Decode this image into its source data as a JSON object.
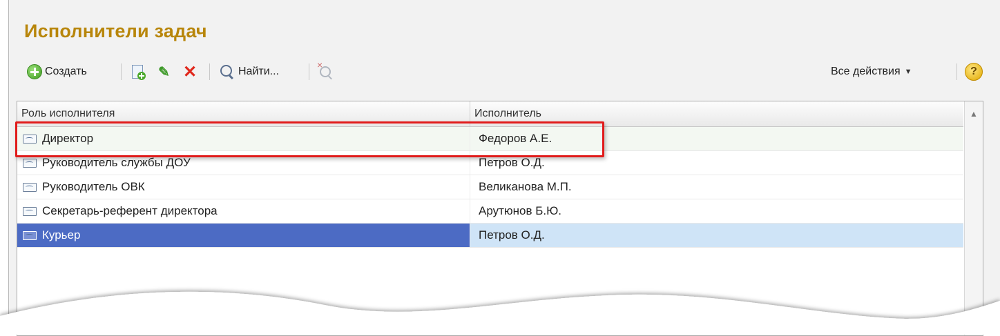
{
  "form": {
    "title": "Исполнители задач"
  },
  "toolbar": {
    "create_label": "Создать",
    "find_label": "Найти...",
    "all_actions_label": "Все действия",
    "all_actions_caret": "▼",
    "help_label": "?"
  },
  "table": {
    "columns": [
      "Роль исполнителя",
      "Исполнитель"
    ],
    "rows": [
      {
        "role": "Директор",
        "performer": "Федоров А.Е."
      },
      {
        "role": "Руководитель службы ДОУ",
        "performer": "Петров О.Д."
      },
      {
        "role": "Руководитель ОВК",
        "performer": "Великанова М.П."
      },
      {
        "role": "Секретарь-референт директора",
        "performer": "Арутюнов Б.Ю."
      },
      {
        "role": "Курьер",
        "performer": "Петров О.Д."
      }
    ],
    "selected_row": 4,
    "highlighted_row": 0
  },
  "colors": {
    "title": "#b8860b",
    "selection": "#4c6bc4",
    "selection_light": "#cfe4f7",
    "highlight_frame": "#e11b1b"
  }
}
